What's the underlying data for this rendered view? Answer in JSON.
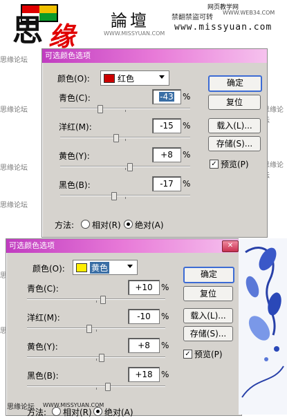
{
  "banner": {
    "logo_char": "思",
    "logo_char2": "缘",
    "title": "論壇",
    "subtitle": "禁翻禁盜可转",
    "site_label": "网页教学网",
    "site_sub": "WWW.WEB34.COM",
    "url": "www.missyuan.com",
    "logo_colors": [
      "#e00000",
      "#f0c000",
      "#ffffff",
      "#0a9a2a"
    ]
  },
  "watermarks": {
    "forum": "思缘论坛",
    "url": "WWW.MISSYUAN.COM"
  },
  "dialog1": {
    "title": "可选颜色选项",
    "color_label": "颜色(O):",
    "color_value": "红色",
    "swatch_color": "#cc0000",
    "rows": [
      {
        "label": "青色(C):",
        "value": "-43",
        "thumb": 0.3,
        "selected": true
      },
      {
        "label": "洋红(M):",
        "value": "-15",
        "thumb": 0.43
      },
      {
        "label": "黄色(Y):",
        "value": "+8",
        "thumb": 0.54
      },
      {
        "label": "黑色(B):",
        "value": "-17",
        "thumb": 0.41
      }
    ],
    "pct": "%",
    "ok": "确定",
    "reset": "复位",
    "load": "载入(L)...",
    "save": "存储(S)...",
    "preview": "预览(P)",
    "method_label": "方法:",
    "relative": "相对(R)",
    "absolute": "绝对(A)"
  },
  "dialog2": {
    "title": "可选颜色选项",
    "color_label": "颜色(O):",
    "color_value": "黄色",
    "swatch_color": "#ffee00",
    "rows": [
      {
        "label": "青色(C):",
        "value": "+10",
        "thumb": 0.55
      },
      {
        "label": "洋红(M):",
        "value": "-10",
        "thumb": 0.45
      },
      {
        "label": "黄色(Y):",
        "value": "+8",
        "thumb": 0.54
      },
      {
        "label": "黑色(B):",
        "value": "+18",
        "thumb": 0.59
      }
    ],
    "pct": "%",
    "ok": "确定",
    "reset": "复位",
    "load": "载入(L)...",
    "save": "存储(S)...",
    "preview": "预览(P)",
    "method_label": "方法:",
    "relative": "相对(R)",
    "absolute": "绝对(A)"
  }
}
